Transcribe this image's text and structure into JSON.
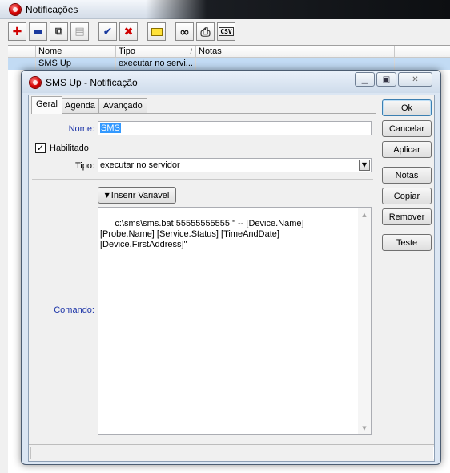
{
  "main_window": {
    "title": "Notificações",
    "toolbar": {
      "items": [
        {
          "icon": "plus-icon",
          "glyph": "✚",
          "color": "#d00000"
        },
        {
          "icon": "minus-icon",
          "glyph": "▬",
          "color": "#1a3a9e"
        },
        {
          "icon": "copy-icon",
          "glyph": "⧉",
          "color": "#333333"
        },
        {
          "icon": "paste-icon",
          "glyph": "▤",
          "color": "#888888"
        },
        {
          "icon": "check-icon",
          "glyph": "✔",
          "color": "#1a3a9e"
        },
        {
          "icon": "cross-icon",
          "glyph": "✖",
          "color": "#d00000"
        },
        {
          "icon": "folder-icon",
          "glyph": "▭",
          "color": "#d4b000"
        },
        {
          "icon": "binoculars-icon",
          "glyph": "∞",
          "color": "#111111"
        },
        {
          "icon": "print-icon",
          "glyph": "⎙",
          "color": "#333333"
        }
      ],
      "csv_label": "CSV"
    },
    "grid": {
      "columns": [
        "Nome",
        "Tipo",
        "Notas"
      ],
      "rows": [
        {
          "nome": "SMS Up",
          "tipo": "executar no servi...",
          "notas": ""
        }
      ]
    }
  },
  "dialog": {
    "title": "SMS Up - Notificação",
    "tabs": [
      "Geral",
      "Agenda",
      "Avançado"
    ],
    "active_tab": "Geral",
    "nome_label": "Nome:",
    "nome_value": "SMS",
    "habilitado_label": "Habilitado",
    "habilitado_checked": true,
    "tipo_label": "Tipo:",
    "tipo_value": "executar no servidor",
    "inserir_label": "Inserir Variável",
    "comando_label": "Comando:",
    "comando_value": "c:\\sms\\sms.bat 55555555555 \" -- [Device.Name] [Probe.Name] [Service.Status] [TimeAndDate] [Device.FirstAddress]\"",
    "buttons": {
      "ok": "Ok",
      "cancelar": "Cancelar",
      "aplicar": "Aplicar",
      "notas": "Notas",
      "copiar": "Copiar",
      "remover": "Remover",
      "teste": "Teste"
    }
  },
  "colors": {
    "label_blue": "#1d35a8",
    "selection_blue": "#3399ff",
    "row_highlight": "#c2dbf4"
  }
}
